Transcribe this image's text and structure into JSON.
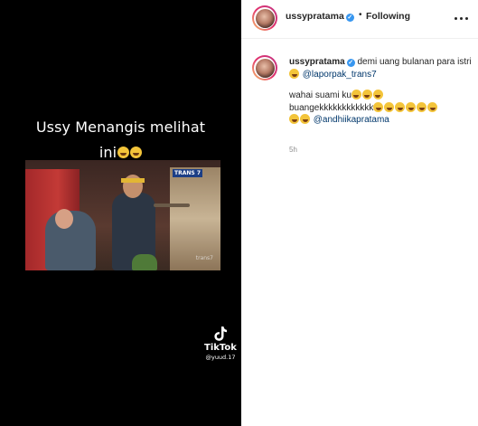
{
  "media": {
    "overlay_line1": "Ussy Menangis melihat",
    "overlay_line2": "ini",
    "video_logo": "TRANS 7",
    "video_watermark": "trans7",
    "tiktok_name": "TikTok",
    "tiktok_handle": "@yuud.17"
  },
  "header": {
    "username": "ussypratama",
    "separator": "•",
    "follow_label": "Following"
  },
  "caption": {
    "username": "ussypratama",
    "text_part1": "demi uang bulanan para istri",
    "mention1": "@laporpak_trans7",
    "line2": "wahai suami ku",
    "line3": "buangekkkkkkkkkkkk",
    "mention2": "@andhiikapratama",
    "time": "5h"
  },
  "colors": {
    "verified_blue": "#3897f0",
    "mention_blue": "#00376b",
    "media_bg": "#000000"
  },
  "icons": [
    "verified-badge-icon",
    "more-options-icon",
    "tiktok-logo-icon",
    "laughing-emoji-icon",
    "rofl-emoji-icon"
  ]
}
